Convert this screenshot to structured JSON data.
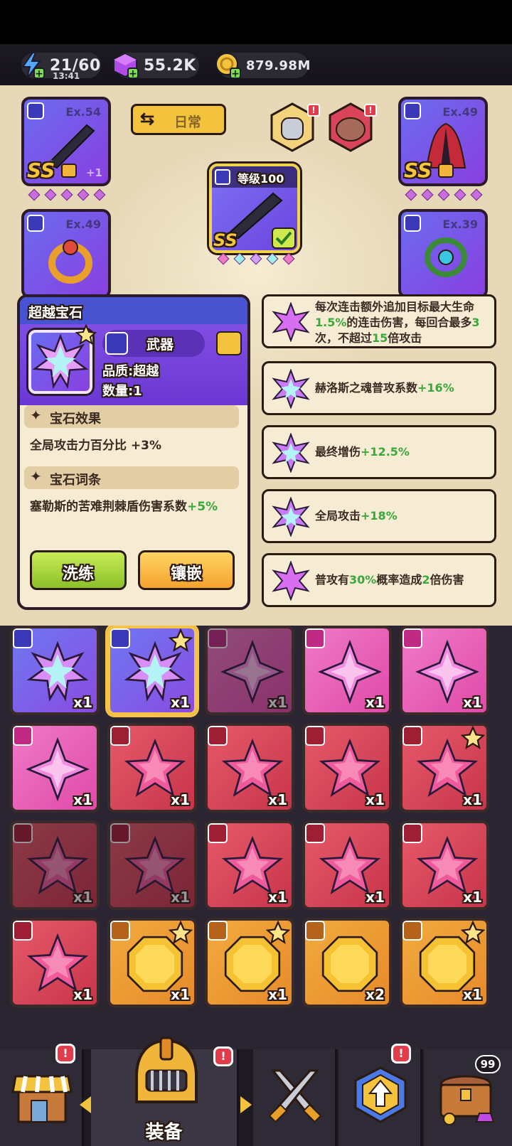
{
  "currency": {
    "energy": "21/60",
    "energy_timer": "13:41",
    "gems": "55.2K",
    "gold": "879.98M"
  },
  "colors": {
    "accent_purple": "#7a4ae0",
    "positive_green": "#3aa83a",
    "gold": "#f4c33e",
    "refine_green": "#a7d63a"
  },
  "equipment": {
    "daily_button": "日常",
    "slots": [
      {
        "name": "weapon-slot",
        "ex": "Ex.54",
        "grade": "SS",
        "bonus": "+1"
      },
      {
        "name": "armor-slot",
        "ex": "Ex.49",
        "grade": "SS"
      },
      {
        "name": "ring-slot",
        "ex": "Ex.49"
      },
      {
        "name": "necklace-slot",
        "ex": "Ex.39"
      }
    ],
    "selected_weapon": {
      "level_label": "等级100",
      "grade": "SS"
    }
  },
  "gem_panel": {
    "title": "超越宝石",
    "type": "武器",
    "quality": "品质:超越",
    "quantity": "数量:1",
    "effect_header": "宝石效果",
    "effect_text": "全局攻击力百分比 +3%",
    "affix_header": "宝石词条",
    "affix_text_main": "塞勒斯的苦难荆棘盾伤害系数",
    "affix_text_value": "+5%",
    "refine_label": "洗练",
    "inlay_label": "镶嵌"
  },
  "affixes": [
    {
      "pre": "每次连击额外追加目标最大生命",
      "v1": "1.5%",
      "mid": "的连击伤害，每回合最多",
      "v2": "3",
      "mid2": "次，不超过",
      "v3": "15",
      "post": "倍攻击"
    },
    {
      "pre": "赫洛斯之魂普攻系数",
      "v1": "+16%"
    },
    {
      "pre": "最终增伤",
      "v1": "+12.5%"
    },
    {
      "pre": "全局攻击",
      "v1": "+18%"
    },
    {
      "pre": "普攻有",
      "v1": "30%",
      "mid": "概率造成",
      "v2": "2",
      "post": "倍伤害"
    }
  ],
  "inventory": [
    {
      "color": "blue",
      "gem": "transcend",
      "count": "x1"
    },
    {
      "color": "blue",
      "gem": "transcend",
      "count": "x1",
      "star": true,
      "selected": true
    },
    {
      "color": "pink",
      "gem": "pink-diamond",
      "count": "x1",
      "dim": true
    },
    {
      "color": "pink",
      "gem": "pink-diamond",
      "count": "x1"
    },
    {
      "color": "pink",
      "gem": "pink-diamond",
      "count": "x1"
    },
    {
      "color": "pink",
      "gem": "pink-diamond",
      "count": "x1"
    },
    {
      "color": "red",
      "gem": "star",
      "count": "x1"
    },
    {
      "color": "red",
      "gem": "star",
      "count": "x1"
    },
    {
      "color": "red",
      "gem": "star",
      "count": "x1"
    },
    {
      "color": "red",
      "gem": "star",
      "count": "x1",
      "star": true
    },
    {
      "color": "red",
      "gem": "star",
      "count": "x1",
      "dim": true
    },
    {
      "color": "red",
      "gem": "star",
      "count": "x1",
      "dim": true
    },
    {
      "color": "red",
      "gem": "star",
      "count": "x1"
    },
    {
      "color": "red",
      "gem": "star",
      "count": "x1"
    },
    {
      "color": "red",
      "gem": "star",
      "count": "x1"
    },
    {
      "color": "red",
      "gem": "star",
      "count": "x1"
    },
    {
      "color": "gold",
      "gem": "gold",
      "count": "x1",
      "star": true
    },
    {
      "color": "gold",
      "gem": "gold",
      "count": "x1",
      "star": true
    },
    {
      "color": "gold",
      "gem": "gold",
      "count": "x2"
    },
    {
      "color": "gold",
      "gem": "gold",
      "count": "x1",
      "star": true
    }
  ],
  "bottom_nav": {
    "equip_label": "装备",
    "chest_count": "99",
    "badge": "!"
  }
}
